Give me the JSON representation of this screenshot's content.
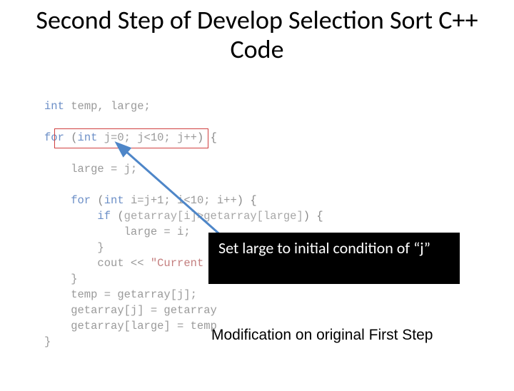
{
  "title": "Second Step of Develop Selection Sort C++ Code",
  "code": {
    "l1_a": "int ",
    "l1_b": "temp, large;",
    "l2_a": "for ",
    "l2_b": "(",
    "l2_c": "int ",
    "l2_d": "j=0; j<10; j++",
    "l2_e": ") {",
    "l3": "    large = j;",
    "l4_a": "    for ",
    "l4_b": "(",
    "l4_c": "int ",
    "l4_d": "i=j+1; i<10; i++",
    "l4_e": ") {",
    "l5_a": "        if ",
    "l5_b": "(",
    "l5_c": "getarray[i]>getarray[large]",
    "l5_d": ") {",
    "l6": "            large = i;",
    "l7": "        }",
    "l8_a": "        cout << ",
    "l8_b": "\"Current L",
    "l9": "    }",
    "l10": "    temp = getarray[j];",
    "l11": "    getarray[j] = getarray",
    "l12": "    getarray[large] = temp",
    "l13": "}"
  },
  "callout": "Set large to initial condition of “j”",
  "caption": "Modification on original First Step",
  "colors": {
    "highlight_border": "#d04040",
    "arrow": "#4e86c8",
    "callout_bg": "#000000",
    "callout_fg": "#ffffff"
  }
}
